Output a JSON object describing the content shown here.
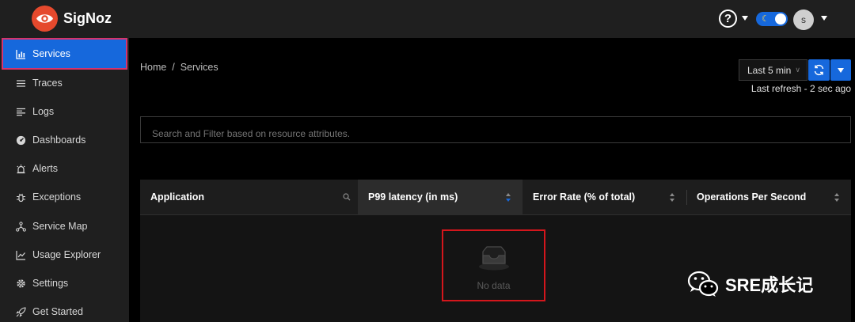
{
  "header": {
    "brand": "SigNoz",
    "help_glyph": "?",
    "avatar_initial": "s",
    "theme_icon": "moon-icon"
  },
  "sidebar": {
    "items": [
      {
        "label": "Services",
        "icon": "bar-chart-icon",
        "active": true
      },
      {
        "label": "Traces",
        "icon": "menu-icon"
      },
      {
        "label": "Logs",
        "icon": "align-left-icon"
      },
      {
        "label": "Dashboards",
        "icon": "dashboard-icon"
      },
      {
        "label": "Alerts",
        "icon": "alarm-icon"
      },
      {
        "label": "Exceptions",
        "icon": "bug-icon"
      },
      {
        "label": "Service Map",
        "icon": "deployment-icon"
      },
      {
        "label": "Usage Explorer",
        "icon": "line-chart-icon"
      },
      {
        "label": "Settings",
        "icon": "gear-icon"
      },
      {
        "label": "Get Started",
        "icon": "rocket-icon"
      }
    ]
  },
  "main": {
    "breadcrumb": "Home  /  Services",
    "time_range": "Last 5 min",
    "last_refresh": "Last refresh - 2 sec ago",
    "search_placeholder": "Search and Filter based on resource attributes.",
    "table": {
      "columns": [
        {
          "label": "Application"
        },
        {
          "label": "P99 latency (in ms)"
        },
        {
          "label": "Error Rate (% of total)"
        },
        {
          "label": "Operations Per Second"
        }
      ],
      "empty_text": "No data"
    }
  },
  "watermark": {
    "text": "SRE成长记"
  },
  "colors": {
    "accent": "#1668dc",
    "logo": "#e5492d",
    "header_bg": "#1f1f1f",
    "highlight_border": "#d4161c"
  }
}
